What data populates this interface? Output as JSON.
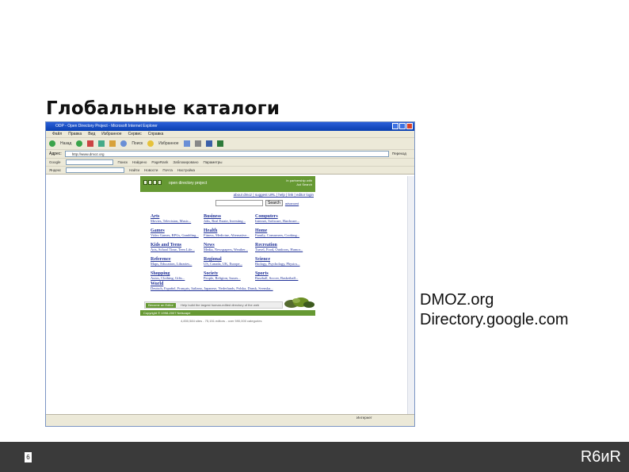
{
  "slide": {
    "title": "Глобальные каталоги",
    "caption_lines": [
      "DMOZ.org",
      "Directory.google.com"
    ],
    "page_number": "6",
    "brand": "R6иR"
  },
  "browser": {
    "window_title": "ODP - Open Directory Project - Microsoft Internet Explorer",
    "menu": [
      "Файл",
      "Правка",
      "Вид",
      "Избранное",
      "Сервис",
      "Справка"
    ],
    "toolbar": {
      "back": "Назад",
      "search": "Поиск",
      "favorites": "Избранное"
    },
    "address": {
      "label": "Адрес:",
      "value": "http://www.dmoz.org",
      "go": "Переход"
    },
    "links": {
      "label": "Google",
      "search_btn": "Поиск",
      "items": [
        "Найдено",
        "PageRank",
        "Заблокировано",
        "Параметры"
      ]
    },
    "googlebar": {
      "label": "Яндекс",
      "items": [
        "Найти",
        "Новости",
        "Почта",
        "Настройка"
      ]
    },
    "status": "Интернет"
  },
  "dmoz": {
    "tagline": "open directory project",
    "header_right": [
      "In partnership with",
      "Aol Search"
    ],
    "nav_links": "about dmoz | suggest URL | help | link | editor login",
    "search_button": "Search",
    "advanced": "advanced",
    "categories": [
      {
        "title": "Arts",
        "subs": "Movies, Television, Music..."
      },
      {
        "title": "Business",
        "subs": "Jobs, Real Estate, Investing..."
      },
      {
        "title": "Computers",
        "subs": "Internet, Software, Hardware..."
      },
      {
        "title": "Games",
        "subs": "Video Games, RPGs, Gambling..."
      },
      {
        "title": "Health",
        "subs": "Fitness, Medicine, Alternative..."
      },
      {
        "title": "Home",
        "subs": "Family, Consumers, Cooking..."
      },
      {
        "title": "Kids and Teens",
        "subs": "Arts, School Time, Teen Life..."
      },
      {
        "title": "News",
        "subs": "Media, Newspapers, Weather..."
      },
      {
        "title": "Recreation",
        "subs": "Travel, Food, Outdoors, Humor..."
      },
      {
        "title": "Reference",
        "subs": "Maps, Education, Libraries..."
      },
      {
        "title": "Regional",
        "subs": "US, Canada, UK, Europe..."
      },
      {
        "title": "Science",
        "subs": "Biology, Psychology, Physics..."
      },
      {
        "title": "Shopping",
        "subs": "Autos, Clothing, Gifts..."
      },
      {
        "title": "Society",
        "subs": "People, Religion, Issues..."
      },
      {
        "title": "Sports",
        "subs": "Baseball, Soccer, Basketball..."
      }
    ],
    "world": {
      "title": "World",
      "subs": "Deutsch, Español, Français, Italiano, Japanese, Nederlands, Polska, Dansk, Svenska..."
    },
    "become_editor": "Become an Editor",
    "become_text": "Help build the largest human-edited directory of the web",
    "copyright": "Copyright © 1998-2007 Netscape",
    "footnote": "4,830,584 sites - 75,151 editors - over 590,000 categories"
  }
}
